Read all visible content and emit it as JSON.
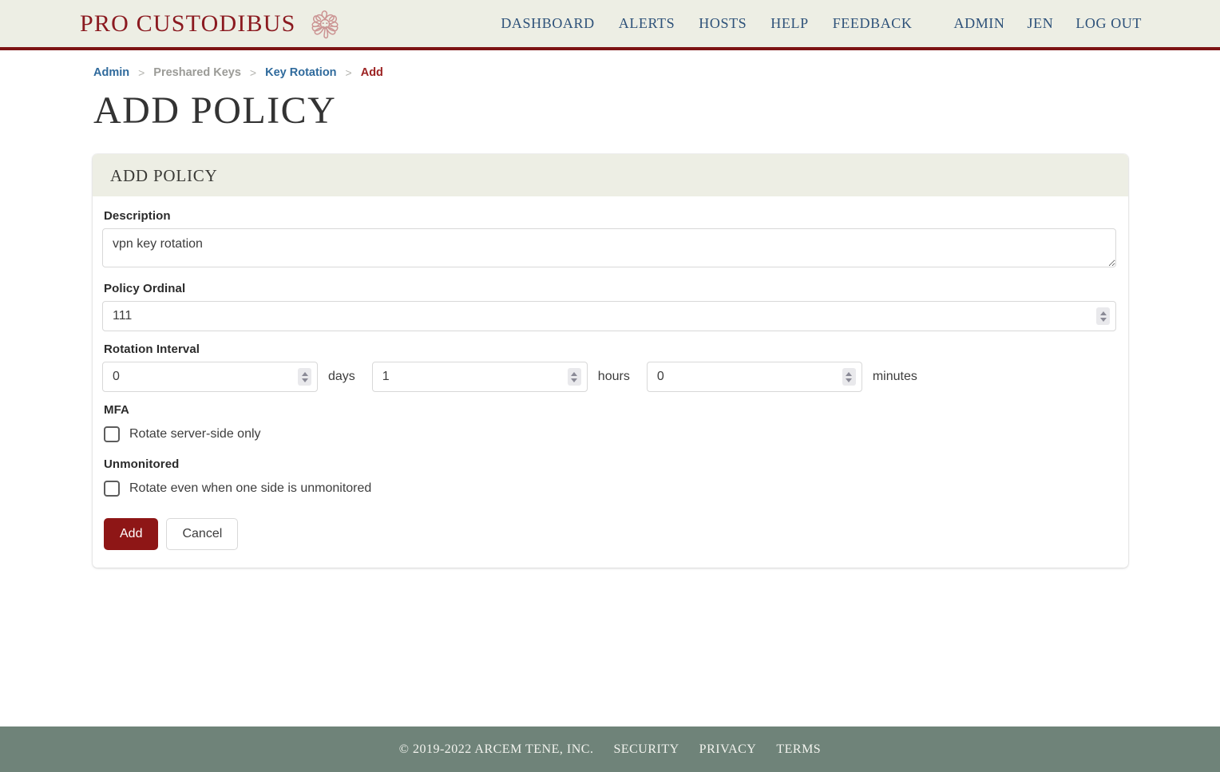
{
  "header": {
    "brand_name": "PRO CUSTODIBUS",
    "logo_icon": "medusa-emblem-icon",
    "nav_primary": [
      {
        "label": "DASHBOARD"
      },
      {
        "label": "ALERTS"
      },
      {
        "label": "HOSTS"
      },
      {
        "label": "HELP"
      },
      {
        "label": "FEEDBACK"
      }
    ],
    "nav_secondary": [
      {
        "label": "ADMIN"
      },
      {
        "label": "JEN"
      },
      {
        "label": "LOG OUT"
      }
    ]
  },
  "breadcrumb": {
    "items": [
      {
        "label": "Admin",
        "style": "link"
      },
      {
        "label": "Preshared Keys",
        "style": "muted"
      },
      {
        "label": "Key Rotation",
        "style": "link"
      },
      {
        "label": "Add",
        "style": "current"
      }
    ],
    "separator": ">"
  },
  "page": {
    "title": "ADD POLICY"
  },
  "card": {
    "header_title": "ADD POLICY",
    "fields": {
      "description": {
        "label": "Description",
        "value": "vpn key rotation",
        "placeholder": ""
      },
      "policy_ordinal": {
        "label": "Policy Ordinal",
        "value": "111",
        "placeholder": ""
      },
      "rotation_interval": {
        "label": "Rotation Interval",
        "days": {
          "value": "0",
          "unit": "days"
        },
        "hours": {
          "value": "1",
          "unit": "hours"
        },
        "minutes": {
          "value": "0",
          "unit": "minutes"
        }
      },
      "mfa": {
        "label": "MFA",
        "checkbox_label": "Rotate server-side only",
        "checked": false
      },
      "unmonitored": {
        "label": "Unmonitored",
        "checkbox_label": "Rotate even when one side is unmonitored",
        "checked": false
      }
    },
    "actions": {
      "submit_label": "Add",
      "cancel_label": "Cancel"
    }
  },
  "footer": {
    "copyright": "© 2019-2022 ARCEM TENE, INC.",
    "links": [
      {
        "label": "SECURITY"
      },
      {
        "label": "PRIVACY"
      },
      {
        "label": "TERMS"
      }
    ]
  },
  "colors": {
    "brand_red": "#8b1a20",
    "header_bg": "#edeee4",
    "header_rule": "#7d1414",
    "nav_blue": "#2d5179",
    "link_blue": "#2f6a9c",
    "current_crumb": "#9c2222",
    "primary_button": "#8e1616",
    "footer_bg": "#6f8379"
  }
}
